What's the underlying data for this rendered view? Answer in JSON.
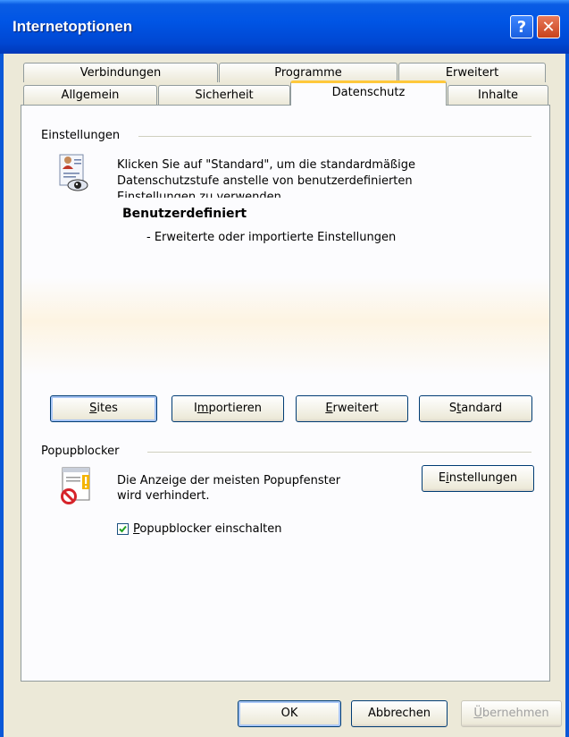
{
  "window": {
    "title": "Internetoptionen",
    "help_glyph": "?",
    "close_glyph": "✕"
  },
  "tabs": {
    "row1": [
      "Verbindungen",
      "Programme",
      "Erweitert"
    ],
    "row2": [
      "Allgemein",
      "Sicherheit",
      "Datenschutz",
      "Inhalte"
    ],
    "active": "Datenschutz"
  },
  "settings": {
    "group_label": "Einstellungen",
    "description_line1": "Klicken Sie auf \"Standard\", um die standardmäßige",
    "description_line2": "Datenschutzstufe anstelle von benutzerdefinierten",
    "description_line3": "Einstellungen zu verwenden.",
    "level_title": "Benutzerdefiniert",
    "level_detail": "- Erweiterte oder importierte Einstellungen",
    "buttons": {
      "sites": {
        "label_pre": "",
        "label_u": "S",
        "label_post": "ites"
      },
      "import": {
        "label_pre": "I",
        "label_u": "m",
        "label_post": "portieren"
      },
      "advanced": {
        "label_pre": "",
        "label_u": "E",
        "label_post": "rweitert"
      },
      "default": {
        "label_pre": "S",
        "label_u": "t",
        "label_post": "andard"
      }
    }
  },
  "popup": {
    "group_label": "Popupblocker",
    "description_line1": "Die Anzeige der meisten Popupfenster",
    "description_line2": "wird verhindert.",
    "settings_button": {
      "label_pre": "E",
      "label_u": "i",
      "label_post": "nstellungen"
    },
    "checkbox": {
      "label_u": "P",
      "label_post": "opupblocker einschalten",
      "checked": true
    }
  },
  "footer": {
    "ok": "OK",
    "cancel": "Abbrechen",
    "apply": {
      "label_u": "Ü",
      "label_post": "bernehmen"
    }
  },
  "icons": [
    "privacy-policy-icon",
    "popup-blocked-icon",
    "checkmark-icon"
  ]
}
